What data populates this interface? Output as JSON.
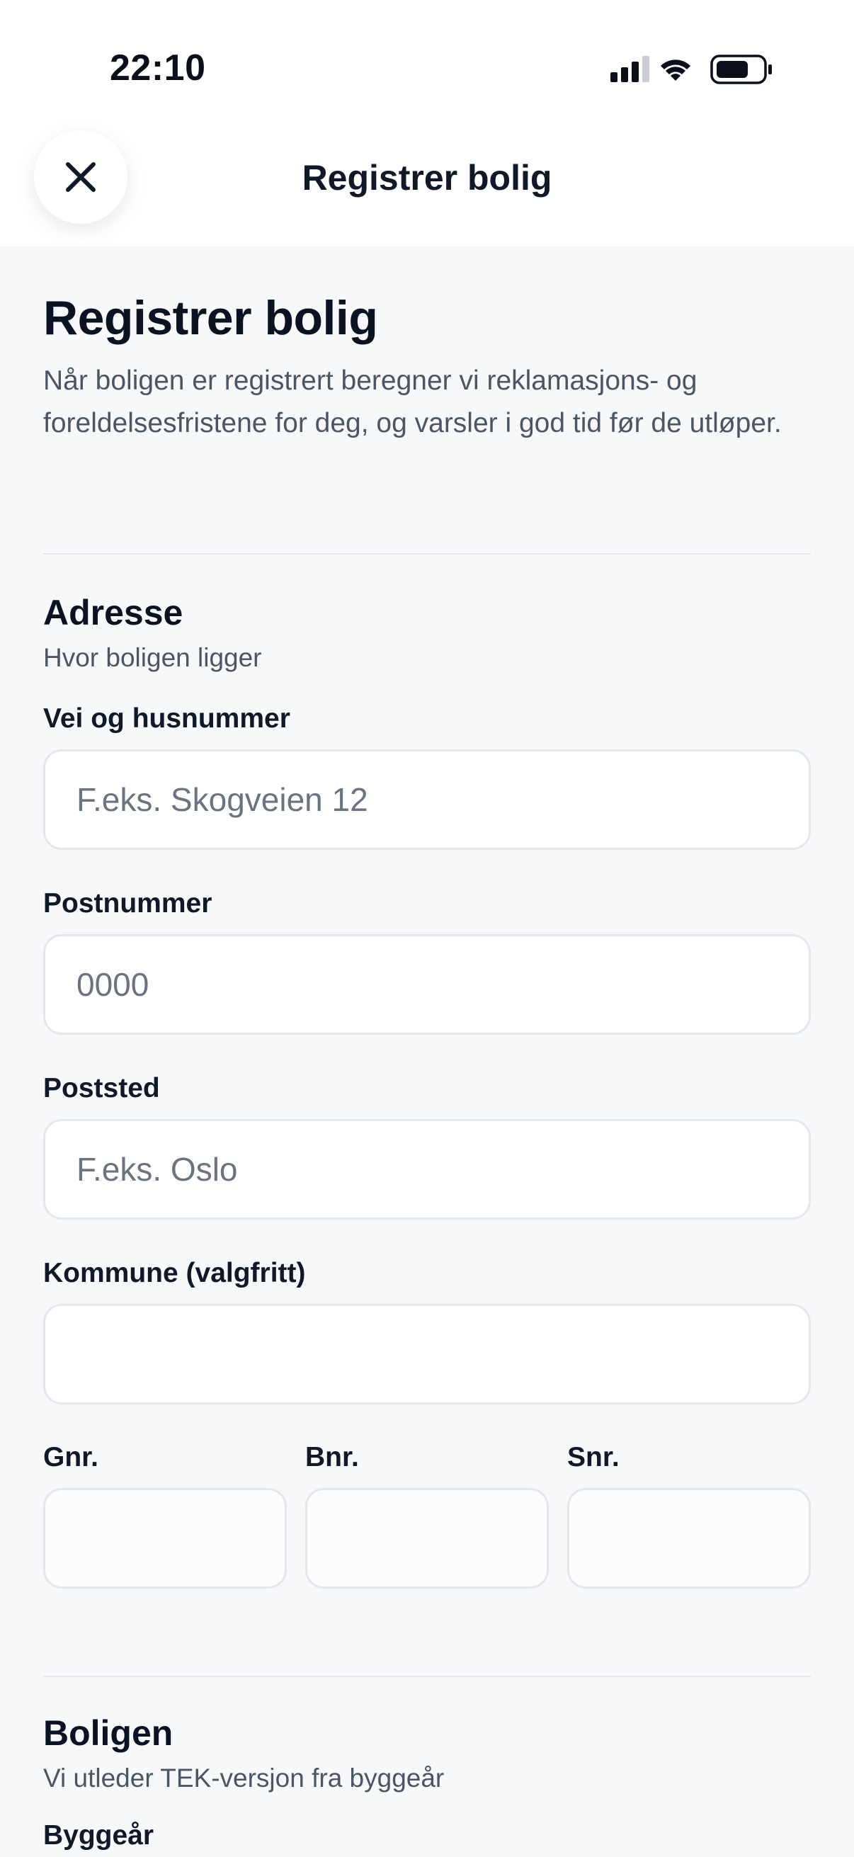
{
  "status_bar": {
    "time": "22:10"
  },
  "header": {
    "title": "Registrer bolig"
  },
  "intro": {
    "title": "Registrer bolig",
    "subtitle": "Når boligen er registrert beregner vi reklamasjons- og foreldelsesfristene for deg, og varsler i god tid før de utløper."
  },
  "address": {
    "title": "Adresse",
    "subtitle": "Hvor boligen ligger",
    "street": {
      "label": "Vei og husnummer",
      "placeholder": "F.eks. Skogveien 12",
      "value": ""
    },
    "postal_code": {
      "label": "Postnummer",
      "placeholder": "0000",
      "value": ""
    },
    "city": {
      "label": "Poststed",
      "placeholder": "F.eks. Oslo",
      "value": ""
    },
    "municipality": {
      "label": "Kommune (valgfritt)",
      "placeholder": "",
      "value": ""
    },
    "gnr": {
      "label": "Gnr.",
      "value": ""
    },
    "bnr": {
      "label": "Bnr.",
      "value": ""
    },
    "snr": {
      "label": "Snr.",
      "value": ""
    }
  },
  "dwelling": {
    "title": "Boligen",
    "subtitle": "Vi utleder TEK-versjon fra byggeår",
    "build_year": {
      "label": "Byggeår"
    }
  },
  "icons": {
    "close": "close-icon",
    "signal": "cellular-signal-icon",
    "wifi": "wifi-icon",
    "battery": "battery-icon"
  },
  "colors": {
    "background": "#F7F8FA",
    "surface": "#FFFFFF",
    "text_primary": "#111827",
    "text_secondary": "#4B5563",
    "border": "#E3E7EC"
  }
}
